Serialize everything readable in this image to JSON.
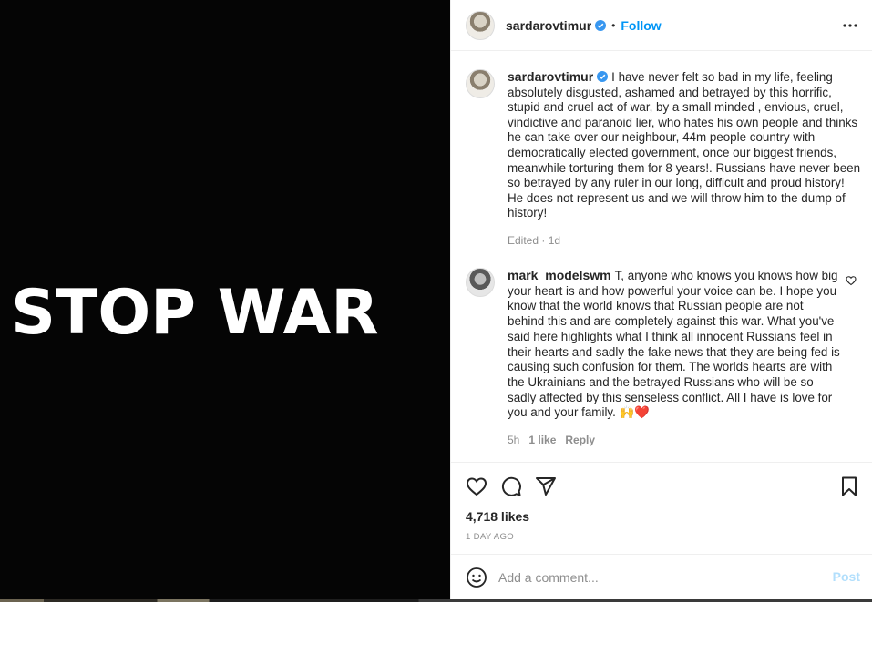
{
  "media": {
    "overlay_text": "STOP WAR",
    "background": "#050505"
  },
  "header": {
    "username": "sardarovtimur",
    "verified": true,
    "separator": "•",
    "follow_label": "Follow"
  },
  "caption": {
    "username": "sardarovtimur",
    "text": "I have never felt so bad in my life, feeling absolutely disgusted, ashamed and betrayed by this horrific, stupid and cruel act of war, by a small minded , envious, cruel, vindictive and paranoid lier, who hates his own people and thinks he can take over our neighbour, 44m people country with democratically elected government, once our biggest friends, meanwhile torturing them for 8 years!. Russians have never been so betrayed by any ruler in our long, difficult and proud history! He does not represent us and we will throw him to the dump of history!",
    "meta": "Edited · 1d"
  },
  "comment": {
    "username": "mark_modelswm",
    "text": "T, anyone who knows you knows how big your heart is and how powerful your voice can be. I hope you know that the world knows that Russian people are not behind this and are completely against this war. What you've said here highlights what I think all innocent Russians feel in their hearts and sadly the fake news that they are being fed is causing such confusion for them. The worlds hearts are with the Ukrainians and the betrayed Russians who will be so sadly affected by this senseless conflict. All I have is love for you and your family. 🙌❤️",
    "time": "5h",
    "likes": "1 like",
    "reply_label": "Reply"
  },
  "post": {
    "likes": "4,718 likes",
    "date": "1 DAY AGO"
  },
  "add_comment": {
    "placeholder": "Add a comment...",
    "post_label": "Post"
  },
  "colors": {
    "accent": "#0095f6",
    "post_disabled": "#b2dffc",
    "muted": "#8e8e8e",
    "verified": "#3897f0",
    "heart": "#ed4956"
  },
  "icons": [
    "more-icon",
    "verified-icon",
    "heart-icon",
    "comment-icon",
    "share-icon",
    "bookmark-icon",
    "emoji-icon"
  ]
}
